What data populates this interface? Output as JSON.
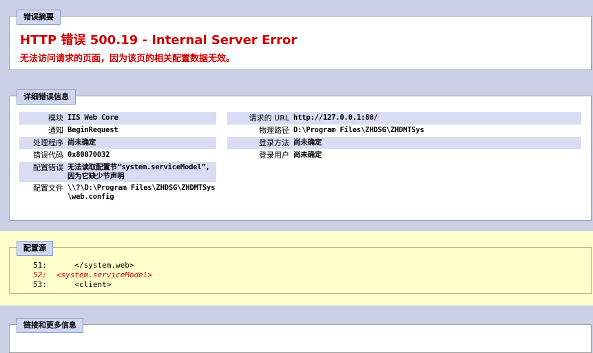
{
  "summary": {
    "legend": "错误摘要",
    "title": "HTTP 错误 500.19 - Internal Server Error",
    "description": "无法访问请求的页面，因为该页的相关配置数据无效。"
  },
  "details": {
    "legend": "详细错误信息",
    "left": [
      {
        "label": "模块",
        "value": "IIS Web Core"
      },
      {
        "label": "通知",
        "value": "BeginRequest"
      },
      {
        "label": "处理程序",
        "value": "尚未确定"
      },
      {
        "label": "错误代码",
        "value": "0x80070032"
      },
      {
        "label": "配置错误",
        "value": "无法读取配置节“system.serviceModel”，因为它缺少节声明"
      },
      {
        "label": "配置文件",
        "value": "\\\\?\\D:\\Program Files\\ZHDSG\\ZHDMTSys\\web.config"
      }
    ],
    "right": [
      {
        "label": "请求的 URL",
        "value": "http://127.0.0.1:80/"
      },
      {
        "label": "物理路径",
        "value": "D:\\Program Files\\ZHDSG\\ZHDMTSys"
      },
      {
        "label": "登录方法",
        "value": "尚未确定"
      },
      {
        "label": "登录用户",
        "value": "尚未确定"
      }
    ]
  },
  "config_source": {
    "legend": "配置源",
    "lines": [
      {
        "num": "51:",
        "code": "    </system.web>"
      },
      {
        "num": "52:",
        "code": "<system.serviceModel>"
      },
      {
        "num": "53:",
        "code": "    <client>"
      }
    ]
  },
  "links": {
    "legend": "链接和更多信息"
  },
  "colors": {
    "error_red": "#cc0000",
    "band_blue": "#cbcfe8",
    "config_yellow": "#ffffcc",
    "row_alt": "#d9dcf3"
  }
}
